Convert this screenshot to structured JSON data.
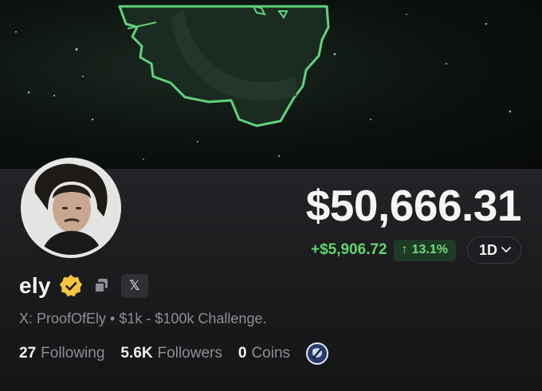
{
  "profile": {
    "name": "ely",
    "bio": "X: ProofOfEly • $1k - $100k Challenge.",
    "x_button_label": "𝕏",
    "verified_color": "#f5c542"
  },
  "portfolio": {
    "balance": "$50,666.31",
    "change_amount": "+$5,906.72",
    "change_arrow": "↑",
    "change_percent": "13.1%",
    "timeframe": "1D",
    "positive_color": "#5fd66e"
  },
  "stats": {
    "following_count": "27",
    "following_label": "Following",
    "followers_count": "5.6K",
    "followers_label": "Followers",
    "coins_count": "0",
    "coins_label": "Coins"
  },
  "icons": {
    "verified": "verified-badge-icon",
    "copy": "copy-icon",
    "x": "x-logo-icon",
    "timeframe": "chevron-down-icon",
    "coin": "coin-badge-icon"
  }
}
